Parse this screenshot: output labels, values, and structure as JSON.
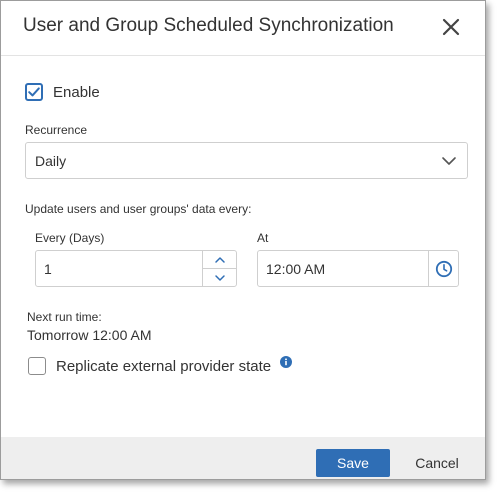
{
  "dialog": {
    "title": "User and Group Scheduled Synchronization"
  },
  "enable": {
    "label": "Enable",
    "checked": true
  },
  "recurrence": {
    "label": "Recurrence",
    "selected": "Daily"
  },
  "update_label": "Update users and user groups' data every:",
  "every_days": {
    "label": "Every (Days)",
    "value": "1"
  },
  "at": {
    "label": "At",
    "value": "12:00 AM"
  },
  "next_run": {
    "label": "Next run time:",
    "value": "Tomorrow 12:00 AM"
  },
  "replicate": {
    "label": "Replicate external provider state",
    "checked": false
  },
  "footer": {
    "save_label": "Save",
    "cancel_label": "Cancel"
  },
  "colors": {
    "accent": "#2f6eb5",
    "footer_bg": "#eeeeee",
    "border": "#cfcfcf"
  },
  "icons": {
    "close": "close-icon",
    "checkmark": "checkmark-icon",
    "chevron": "chevron-down-icon",
    "step_up": "chevron-up-icon",
    "step_down": "chevron-down-icon",
    "clock": "clock-icon",
    "info": "info-icon"
  }
}
